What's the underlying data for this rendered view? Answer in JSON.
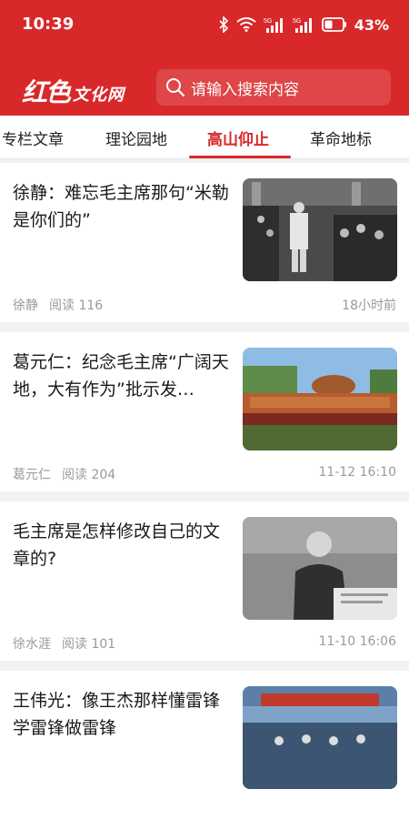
{
  "status_bar": {
    "time": "10:39",
    "battery": "43%",
    "icons": [
      "bluetooth-icon",
      "wifi-icon",
      "signal-5g-icon",
      "signal-5g-icon",
      "battery-icon"
    ]
  },
  "header": {
    "logo_script": "红色",
    "logo_tail": "文化网",
    "search_placeholder": "请输入搜索内容",
    "colors": {
      "primary": "#d9282a"
    }
  },
  "tabs": [
    {
      "label": "专栏文章",
      "active": false
    },
    {
      "label": "理论园地",
      "active": false
    },
    {
      "label": "高山仰止",
      "active": true
    },
    {
      "label": "革命地标",
      "active": false
    }
  ],
  "articles": [
    {
      "title": "徐静：难忘毛主席那句“米勒是你们的”",
      "author": "徐静",
      "views": "阅读 116",
      "time": "18小时前"
    },
    {
      "title": "葛元仁：纪念毛主席“广阔天地，大有作为”批示发…",
      "author": "葛元仁",
      "views": "阅读 204",
      "time": "11-12 16:10"
    },
    {
      "title": "毛主席是怎样修改自己的文章的?",
      "author": "徐水涯",
      "views": "阅读 101",
      "time": "11-10 16:06"
    },
    {
      "title": "王伟光：像王杰那样懂雷锋学雷锋做雷锋",
      "author": "",
      "views": "",
      "time": ""
    }
  ]
}
